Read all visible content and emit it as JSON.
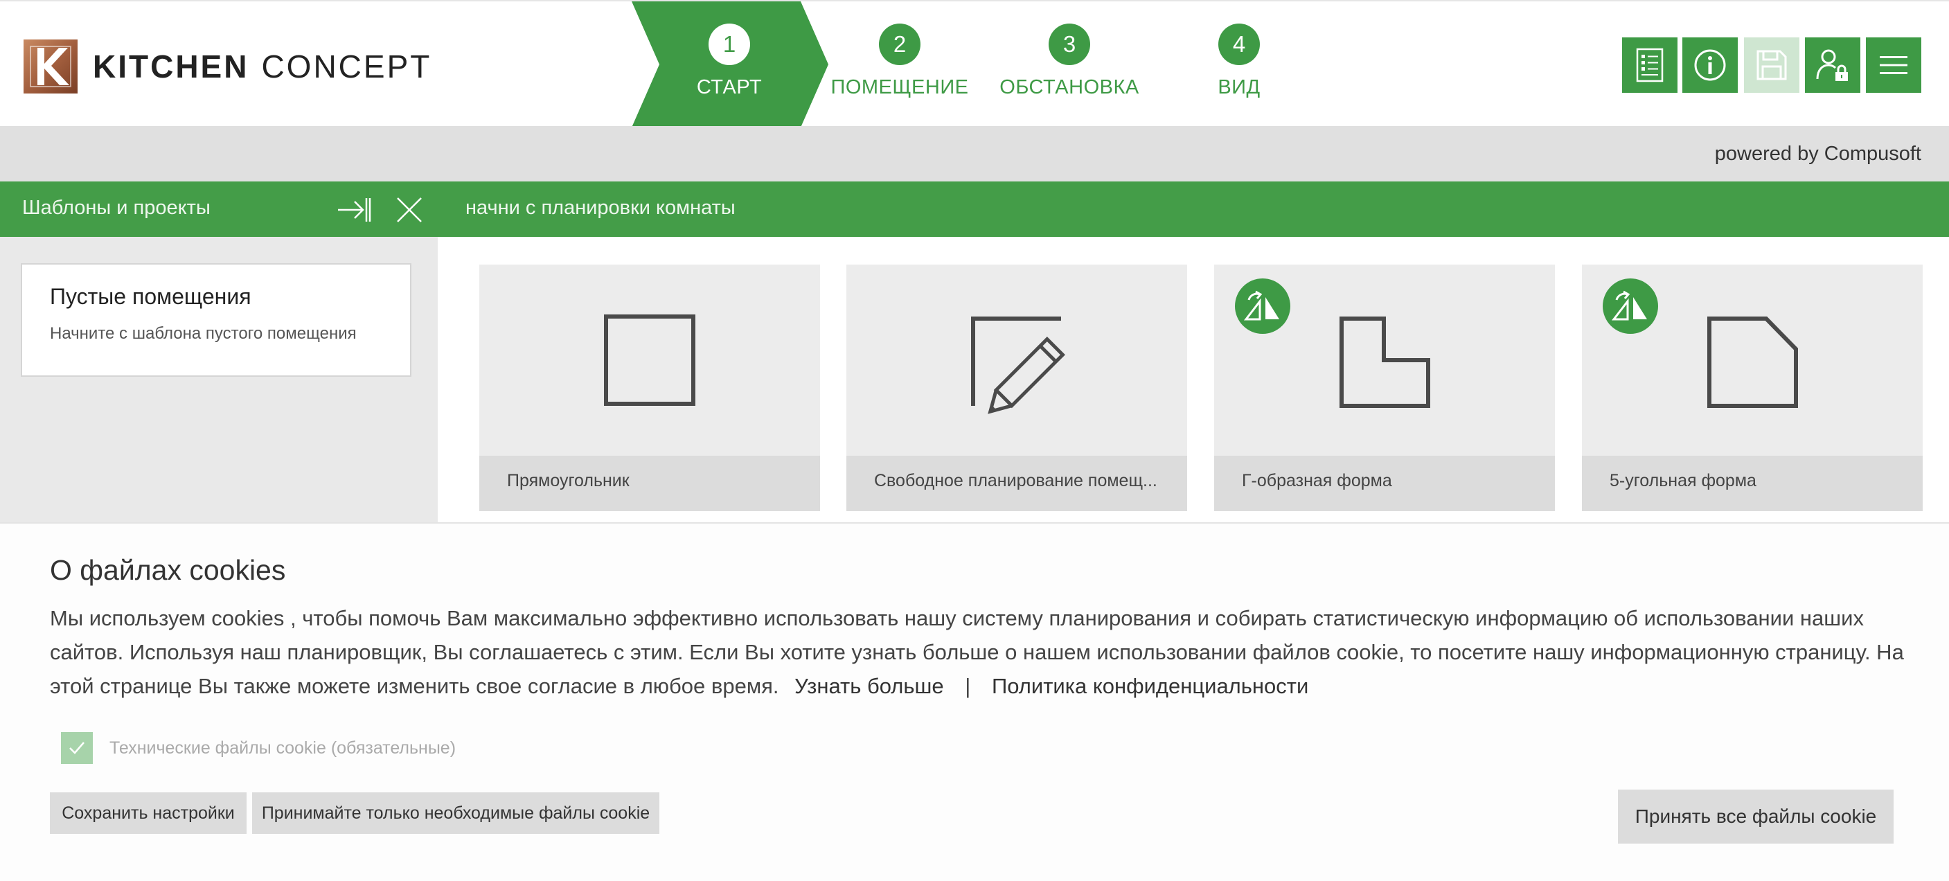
{
  "brand": {
    "name_bold": "KITCHEN",
    "name_light": "CONCEPT",
    "logo_letter": "K"
  },
  "steps": [
    {
      "number": "1",
      "label": "СТАРТ",
      "active": true
    },
    {
      "number": "2",
      "label": "ПОМЕЩЕНИЕ",
      "active": false
    },
    {
      "number": "3",
      "label": "ОБСТАНОВКА",
      "active": false
    },
    {
      "number": "4",
      "label": "ВИД",
      "active": false
    }
  ],
  "toolbar": {
    "buttons": [
      {
        "icon": "list-document-icon",
        "enabled": true
      },
      {
        "icon": "info-icon",
        "enabled": true
      },
      {
        "icon": "save-floppy-icon",
        "enabled": false
      },
      {
        "icon": "user-lock-icon",
        "enabled": true
      },
      {
        "icon": "hamburger-menu-icon",
        "enabled": true
      }
    ]
  },
  "powered_by": "powered by Compusoft",
  "green_bar": {
    "left_title": "Шаблоны и проекты",
    "right_title": "начни с планировки комнаты"
  },
  "sidebar": {
    "card_title": "Пустые помещения",
    "card_description": "Начните с шаблона пустого помещения"
  },
  "tiles": [
    {
      "label": "Прямоугольник",
      "icon": "rectangle-room-icon",
      "badge": false
    },
    {
      "label": "Свободное планирование помещ...",
      "icon": "freeform-pencil-icon",
      "badge": false
    },
    {
      "label": "Г-образная форма",
      "icon": "l-shape-room-icon",
      "badge": true
    },
    {
      "label": "5-угольная форма",
      "icon": "pentagon-room-icon",
      "badge": true
    }
  ],
  "cookie": {
    "title": "О файлах cookies",
    "text": "Мы используем cookies , чтобы помочь Вам максимально эффективно использовать нашу систему планирования и собирать статистическую информацию об использовании наших сайтов. Используя наш планировщик, Вы соглашаетесь с этим. Если Вы хотите узнать больше о нашем использовании файлов cookie, то посетите нашу информационную страницу. На этой странице Вы также можете изменить свое согласие в любое время.",
    "learn_more": "Узнать больше",
    "separator": "|",
    "privacy_policy": "Политика конфиденциальности",
    "technical_label": "Технические файлы cookie (обязательные)",
    "technical_checked": true,
    "save_settings": "Сохранить настройки",
    "accept_necessary": "Принимайте только необходимые файлы cookie",
    "accept_all": "Принять все файлы cookie"
  },
  "colors": {
    "primary_green": "#3e9a45",
    "bar_green": "#449d48",
    "light_green": "#cfe6d1",
    "grey_bar": "#e0e0e0",
    "tile_bg": "#ececec",
    "tile_label_bg": "#dcdcdc",
    "logo_copper": "#a35f3e"
  }
}
